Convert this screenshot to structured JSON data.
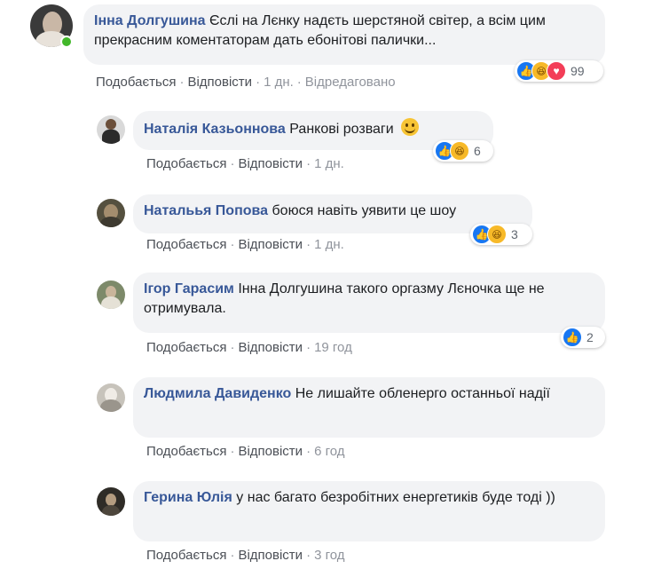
{
  "colors": {
    "author": "#385898",
    "bubble_bg": "#f2f3f5",
    "like": "#1877f2",
    "haha": "#f7b928",
    "love": "#f33e58",
    "online": "#42b72a"
  },
  "comments": [
    {
      "author": "Інна Долгушина",
      "text": "Єслі на Лєнку надєть шерстяной світер, а всім цим прекрасним коментаторам дать ебонітові палички...",
      "like_label": "Подобається",
      "reply_label": "Відповісти",
      "time": "1 дн.",
      "edited": "Відредаговано",
      "reactions": [
        "like-icon",
        "haha-icon",
        "love-icon"
      ],
      "reaction_count": "99"
    },
    {
      "author": "Наталія Казьоннова",
      "text": "Ранкові розваги",
      "emoji": "smile-emoji-icon",
      "like_label": "Подобається",
      "reply_label": "Відповісти",
      "time": "1 дн.",
      "reactions": [
        "like-icon",
        "haha-icon"
      ],
      "reaction_count": "6"
    },
    {
      "author": "Натальья Попова",
      "text": "боюся навіть уявити це шоу",
      "like_label": "Подобається",
      "reply_label": "Відповісти",
      "time": "1 дн.",
      "reactions": [
        "like-icon",
        "haha-icon"
      ],
      "reaction_count": "3"
    },
    {
      "author": "Ігор Гарасим",
      "text": "Інна Долгушина такого оргазму Лєночка ще не отримувала.",
      "like_label": "Подобається",
      "reply_label": "Відповісти",
      "time": "19 год",
      "reactions": [
        "like-icon"
      ],
      "reaction_count": "2"
    },
    {
      "author": "Людмила Давиденко",
      "text": "Не лишайте обленерго останньої надії",
      "like_label": "Подобається",
      "reply_label": "Відповісти",
      "time": "6 год"
    },
    {
      "author": "Герина Юлія",
      "text": "у нас багато безробітних енергетиків буде тоді ))",
      "like_label": "Подобається",
      "reply_label": "Відповісти",
      "time": "3 год"
    }
  ]
}
